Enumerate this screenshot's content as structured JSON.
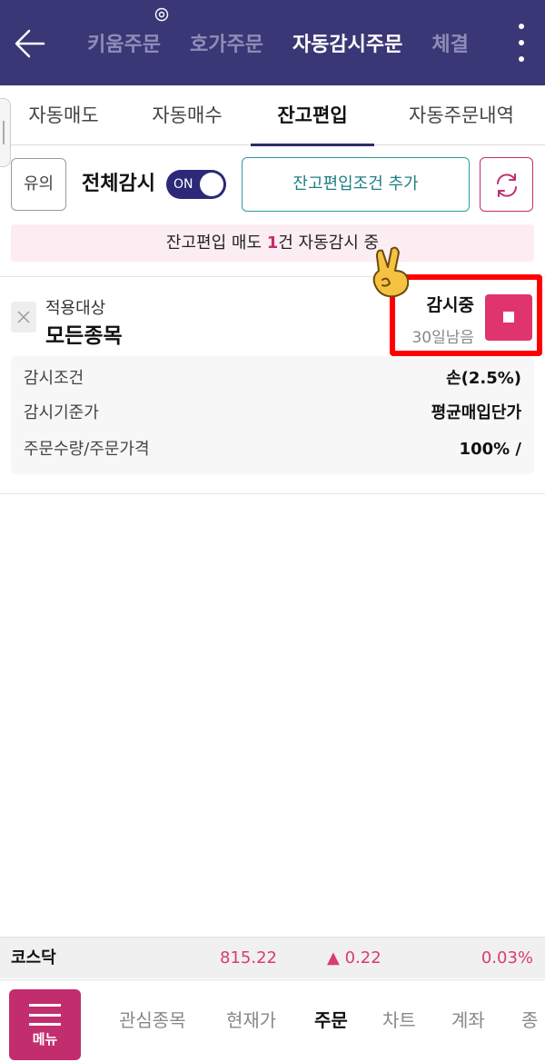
{
  "header": {
    "tabs": [
      {
        "label": "키움주문"
      },
      {
        "label": "호가주문"
      },
      {
        "label": "자동감시주문"
      },
      {
        "label": "체결"
      }
    ]
  },
  "subtabs": [
    {
      "label": "자동매도"
    },
    {
      "label": "자동매수"
    },
    {
      "label": "잔고편입"
    },
    {
      "label": "자동주문내역"
    }
  ],
  "controls": {
    "note_button": "유의",
    "all_watch_label": "전체감시",
    "toggle_text": "ON",
    "add_condition_button": "잔고편입조건 추가"
  },
  "banner": {
    "prefix": "잔고편입 매도 ",
    "count": "1",
    "suffix": "건 자동감시 중"
  },
  "item": {
    "target_label": "적용대상",
    "target_value": "모든종목",
    "status": "감시중",
    "days_left": "30일남음",
    "details": [
      {
        "key": "감시조건",
        "value": "손(2.5%)"
      },
      {
        "key": "감시기준가",
        "value": "평균매입단가"
      },
      {
        "key": "주문수량/주문가격",
        "value": "100% /"
      }
    ]
  },
  "ticker": {
    "name": "코스닥",
    "value": "815.22",
    "change": "▲ 0.22",
    "percent": "0.03%"
  },
  "bottom_nav": {
    "menu_label": "메뉴",
    "items": [
      {
        "label": "관심종목"
      },
      {
        "label": "현재가"
      },
      {
        "label": "주문"
      },
      {
        "label": "차트"
      },
      {
        "label": "계좌"
      },
      {
        "label": "종"
      }
    ]
  },
  "colors": {
    "header_bg": "#3a3776",
    "accent": "#c22d6e",
    "teal": "#1e7f82",
    "highlight_box": "#ff0000"
  }
}
